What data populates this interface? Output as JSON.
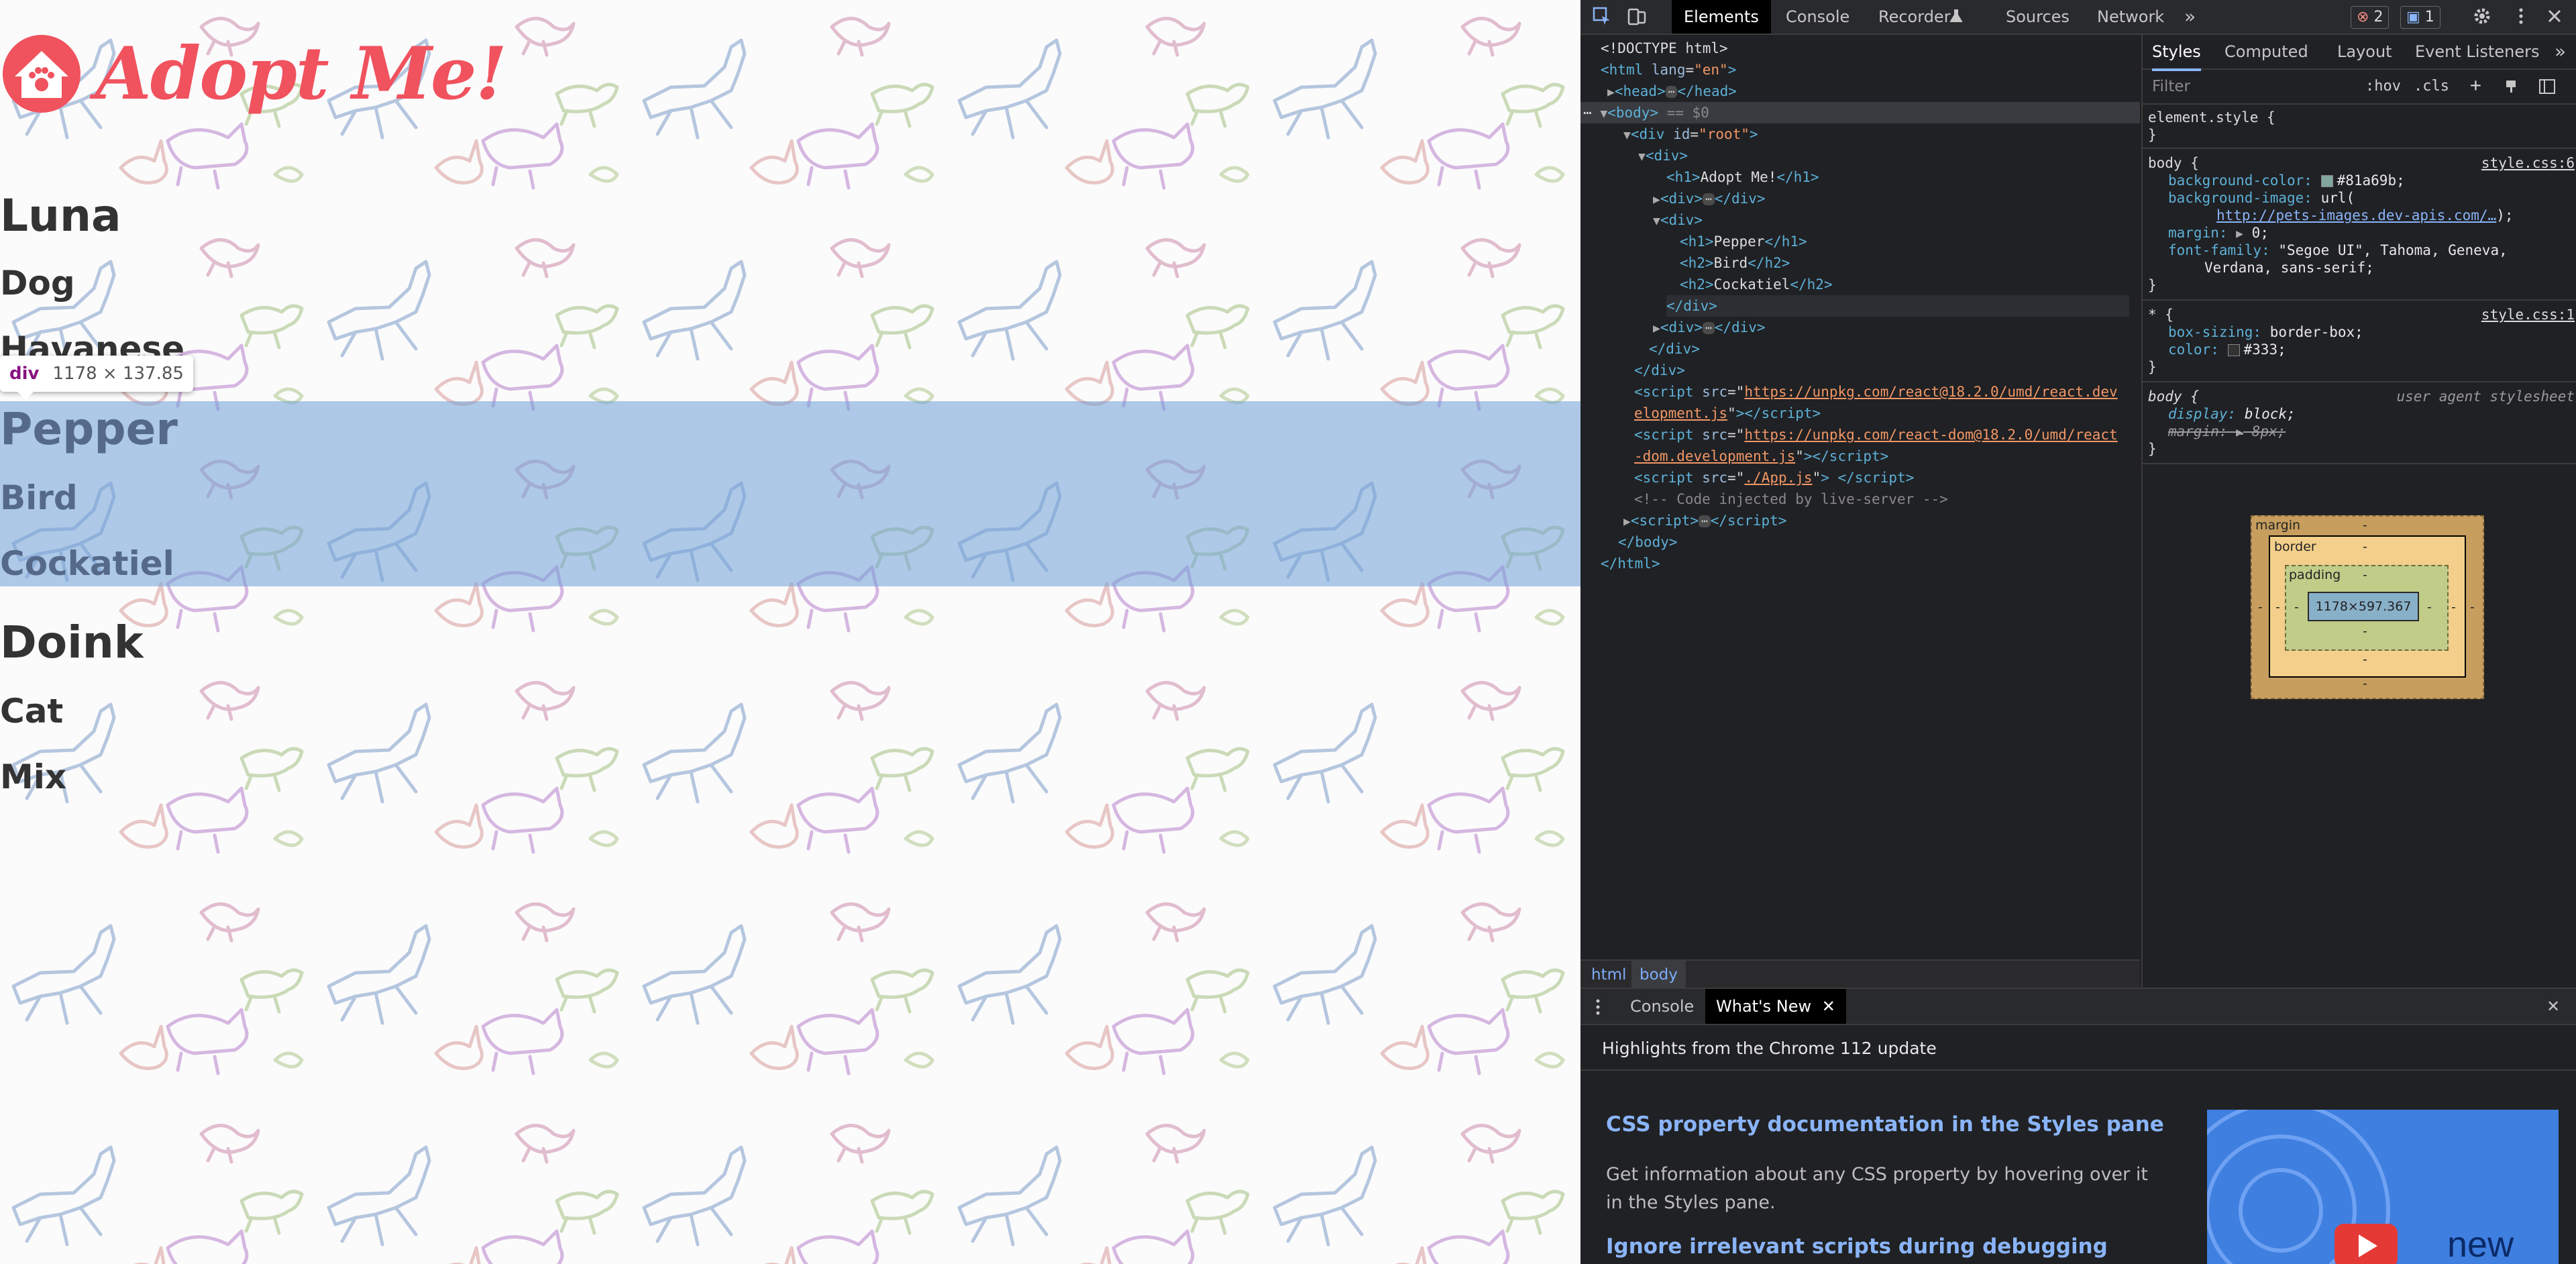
{
  "page": {
    "logo_text": "Adopt Me!",
    "pets": [
      {
        "name": "Luna",
        "animal": "Dog",
        "breed": "Havanese"
      },
      {
        "name": "Pepper",
        "animal": "Bird",
        "breed": "Cockatiel"
      },
      {
        "name": "Doink",
        "animal": "Cat",
        "breed": "Mix"
      }
    ],
    "inspect_tooltip": {
      "tag": "div",
      "size": "1178 × 137.85"
    }
  },
  "devtools": {
    "tabs": [
      "Elements",
      "Console",
      "Recorder",
      "Sources",
      "Network"
    ],
    "more_tabs": "»",
    "error_count": "2",
    "message_count": "1",
    "dom": {
      "doctype": "<!DOCTYPE html>",
      "html_open": "html",
      "html_lang_attr": "lang",
      "html_lang_val": "\"en\"",
      "head": "head",
      "body": "body",
      "body_eq": "== $0",
      "root_div": "div",
      "root_id_attr": "id",
      "root_id_val": "\"root\"",
      "h1_text": "Adopt Me!",
      "pepper_h1": "Pepper",
      "pepper_h2a": "Bird",
      "pepper_h2b": "Cockatiel",
      "react_src_a": "https://unpkg.com/react@18.2.0/umd/react.dev",
      "react_src_b": "elopment.js",
      "reactdom_src_a": "https://unpkg.com/react-dom@18.2.0/umd/react",
      "reactdom_src_b": "-dom.development.js",
      "app_src": "./App.js",
      "comment": "<!-- Code injected by live-server -->",
      "ellipsis": "⋯"
    },
    "breadcrumbs": [
      "html",
      "body"
    ],
    "styles": {
      "tabs": [
        "Styles",
        "Computed",
        "Layout",
        "Event Listeners"
      ],
      "filter_placeholder": "Filter",
      "hov": ":hov",
      "cls": ".cls",
      "element_style": "element.style {",
      "body_selector": "body {",
      "body_source": "style.css:6",
      "bg_color_prop": "background-color:",
      "bg_color_val": "#81a69b;",
      "bg_color_swatch": "#81a69b",
      "bg_image_prop": "background-image:",
      "bg_image_val": "url(",
      "bg_image_url": "http://pets-images.dev-apis.com/…",
      "bg_image_close": ");",
      "margin_prop": "margin:",
      "margin_val": "0;",
      "font_prop": "font-family:",
      "font_val_a": "\"Segoe UI\", Tahoma, Geneva,",
      "font_val_b": "Verdana, sans-serif;",
      "star_selector": "* {",
      "star_source": "style.css:1",
      "box_sizing_prop": "box-sizing:",
      "box_sizing_val": "border-box;",
      "color_prop": "color:",
      "color_val": "#333;",
      "color_swatch": "#333333",
      "ua_selector": "body {",
      "ua_source": "user agent stylesheet",
      "display_prop": "display:",
      "display_val": "block;",
      "ua_margin_prop": "margin:",
      "ua_margin_val": "8px;",
      "close_brace": "}"
    },
    "box_model": {
      "margin_label": "margin",
      "border_label": "border",
      "padding_label": "padding",
      "content": "1178×597.367",
      "dash": "-"
    },
    "drawer": {
      "tabs": [
        "Console",
        "What's New"
      ],
      "heading": "Highlights from the Chrome 112 update",
      "item1_title": "CSS property documentation in the Styles pane",
      "item1_desc": "Get information about any CSS property by hovering over it in the Styles pane.",
      "item2_title": "Ignore irrelevant scripts during debugging",
      "image_text": "new"
    }
  }
}
